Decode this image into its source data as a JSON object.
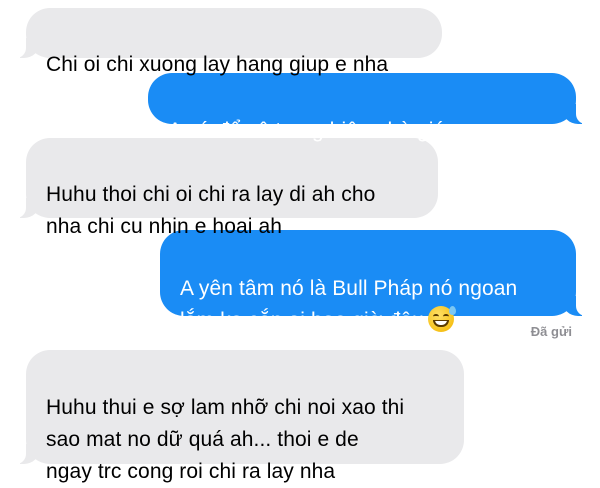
{
  "messages": [
    {
      "direction": "incoming",
      "text": "Chi oi chi xuong lay hang giup e nha"
    },
    {
      "direction": "outgoing",
      "text": "A cứ để vô trong hiên nhà giúp e nga"
    },
    {
      "direction": "incoming",
      "text": "Huhu thoi chi oi chi ra lay di ah cho\nnha chi cu nhin e hoai ah"
    },
    {
      "direction": "outgoing",
      "text": "A yên tâm nó là Bull Pháp nó ngoan\nlắm ko cắn ai bao giờ đâu",
      "emoji": "grinning-face-with-sweat-icon"
    },
    {
      "direction": "incoming",
      "text": "Huhu thui e sợ lam nhỡ chi noi xao thi\nsao mat no dữ quá ah... thoi e de\nngay trc cong roi chi ra lay nha"
    }
  ],
  "delivery_status": "Đã gửi",
  "colors": {
    "incoming_bubble": "#e9e9eb",
    "outgoing_bubble": "#1a8cf5",
    "status_text": "#8e8e93"
  }
}
